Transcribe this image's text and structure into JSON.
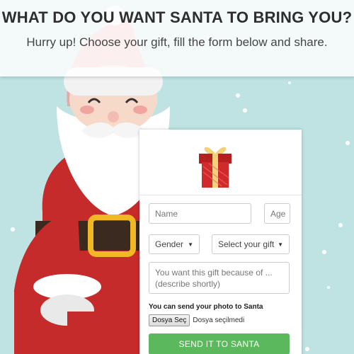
{
  "header": {
    "title": "WHAT DO YOU WANT SANTA TO BRING YOU?",
    "subtitle": "Hurry up! Choose your gift, fill the form below and share."
  },
  "form": {
    "name_placeholder": "Name",
    "age_placeholder": "Age",
    "gender_label": "Gender",
    "gift_label": "Select your gift",
    "reason_placeholder": "You want this gift because of ... (describe shortly)",
    "photo_label": "You can send your photo to Santa",
    "file_button_label": "Dosya Seç",
    "file_status": "Dosya seçilmedi",
    "submit_label": "SEND IT TO SANTA"
  },
  "icons": {
    "gift": "gift-box-icon",
    "caret": "chevron-down-icon"
  },
  "colors": {
    "background": "#bfe3e2",
    "santa_red": "#c62b2b",
    "submit_green": "#5cb85c",
    "gift_red": "#d12a2a",
    "ribbon_gold": "#f1d27a"
  }
}
